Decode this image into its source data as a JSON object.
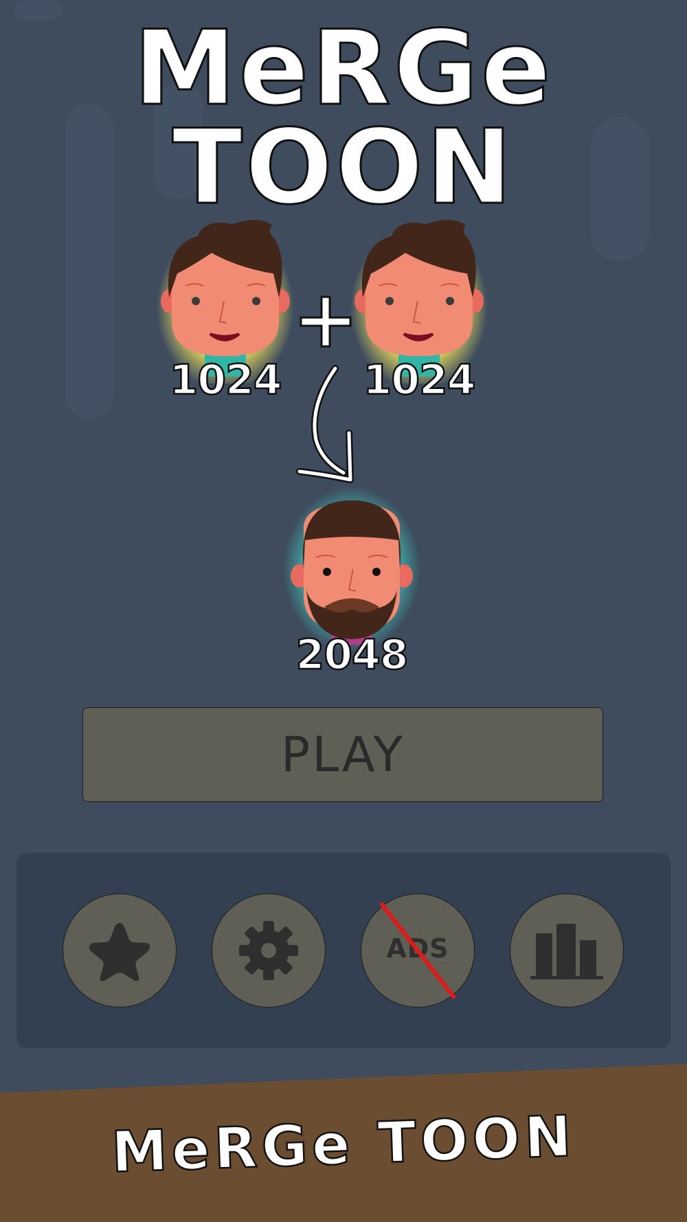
{
  "logo": {
    "line1": "MeRGe",
    "line2": "TOON"
  },
  "merge_demo": {
    "left_toon_value": "1024",
    "right_toon_value": "1024",
    "plus_symbol": "+",
    "result_toon_value": "2048"
  },
  "play_button": {
    "label": "PLAY"
  },
  "menu": {
    "buttons": [
      {
        "icon": "star-icon"
      },
      {
        "icon": "gear-icon"
      },
      {
        "icon": "no-ads-icon",
        "label": "ADS"
      },
      {
        "icon": "leaderboard-icon"
      }
    ]
  },
  "footer": {
    "title": "MeRGe TOON"
  },
  "colors": {
    "background": "#3e4c5e",
    "panel": "#334052",
    "button": "#5f5f55",
    "ground": "#6b4d31",
    "glow_yellow": "#fff25a",
    "glow_teal": "#3fd6c8",
    "no_ads_slash": "#e0191b"
  }
}
